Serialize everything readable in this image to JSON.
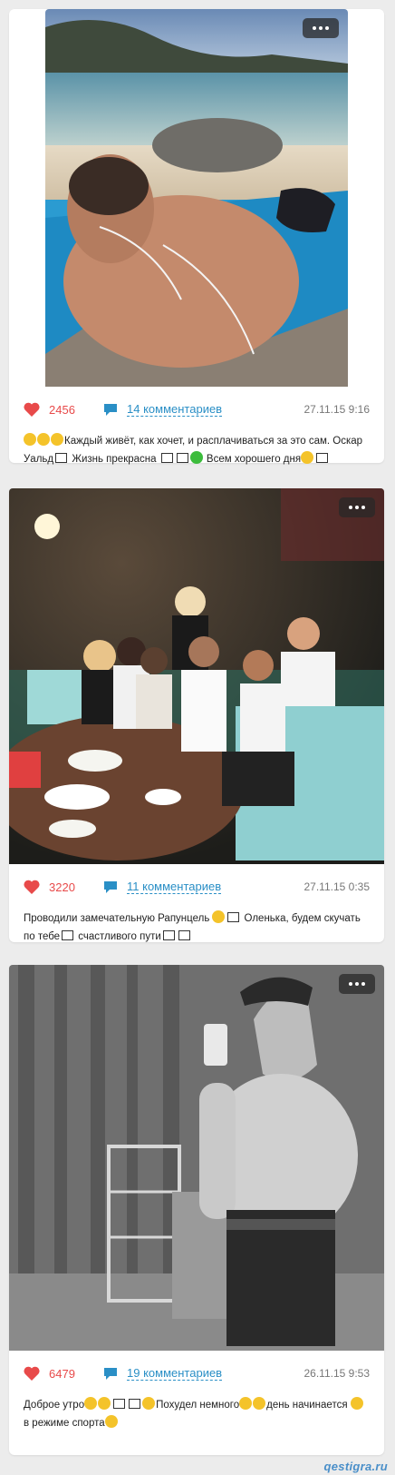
{
  "posts": [
    {
      "photo_desc": "beach selfie",
      "likes": "2456",
      "comments": "14 комментариев",
      "date": "27.11.15 9:16",
      "caption_a": "Каждый живёт, как хочет, и расплачиваться за это сам. Оскар Уальд",
      "caption_b": " Жизнь прекрасна ",
      "caption_c": " Всем хорошего дня"
    },
    {
      "photo_desc": "group evening",
      "likes": "3220",
      "comments": "11 комментариев",
      "date": "27.11.15 0:35",
      "caption_a": "Проводили замечательную Рапунцель",
      "caption_b": " Оленька, будем скучать по тебе",
      "caption_c": " счастливого пути"
    },
    {
      "photo_desc": "mirror selfie",
      "likes": "6479",
      "comments": "19 комментариев",
      "date": "26.11.15 9:53",
      "caption_a": "Доброе утро",
      "caption_b": "Похудел немного",
      "caption_c": "день начинается",
      "caption_d": " в режиме спорта"
    }
  ],
  "watermark": "qestigra.ru",
  "colors": {
    "like": "#e84a4a",
    "link": "#2a8fc6"
  },
  "icons": [
    "heart-icon",
    "chat-icon",
    "more-icon"
  ]
}
